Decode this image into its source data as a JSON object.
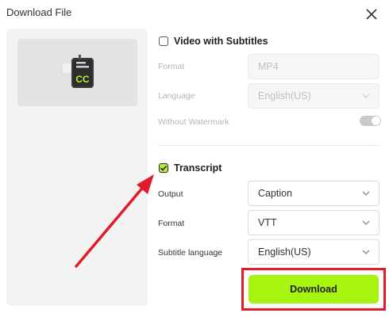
{
  "dialog": {
    "title": "Download File",
    "close_icon": "close-icon"
  },
  "preview": {
    "icon": "caption-file-icon",
    "icon_text": "CC"
  },
  "video_section": {
    "label": "Video with Subtitles",
    "checked": false,
    "format": {
      "label": "Format",
      "value": "MP4"
    },
    "language": {
      "label": "Language",
      "value": "English(US)"
    },
    "watermark": {
      "label": "Without Watermark",
      "toggle_on": true
    }
  },
  "transcript_section": {
    "label": "Transcript",
    "checked": true,
    "output": {
      "label": "Output",
      "value": "Caption"
    },
    "format": {
      "label": "Format",
      "value": "VTT"
    },
    "subtitle_language": {
      "label": "Subtitle language",
      "value": "English(US)"
    }
  },
  "download_button": {
    "label": "Download"
  },
  "colors": {
    "accent_green": "#a6f40f",
    "annotation_red": "#e01c2a"
  }
}
